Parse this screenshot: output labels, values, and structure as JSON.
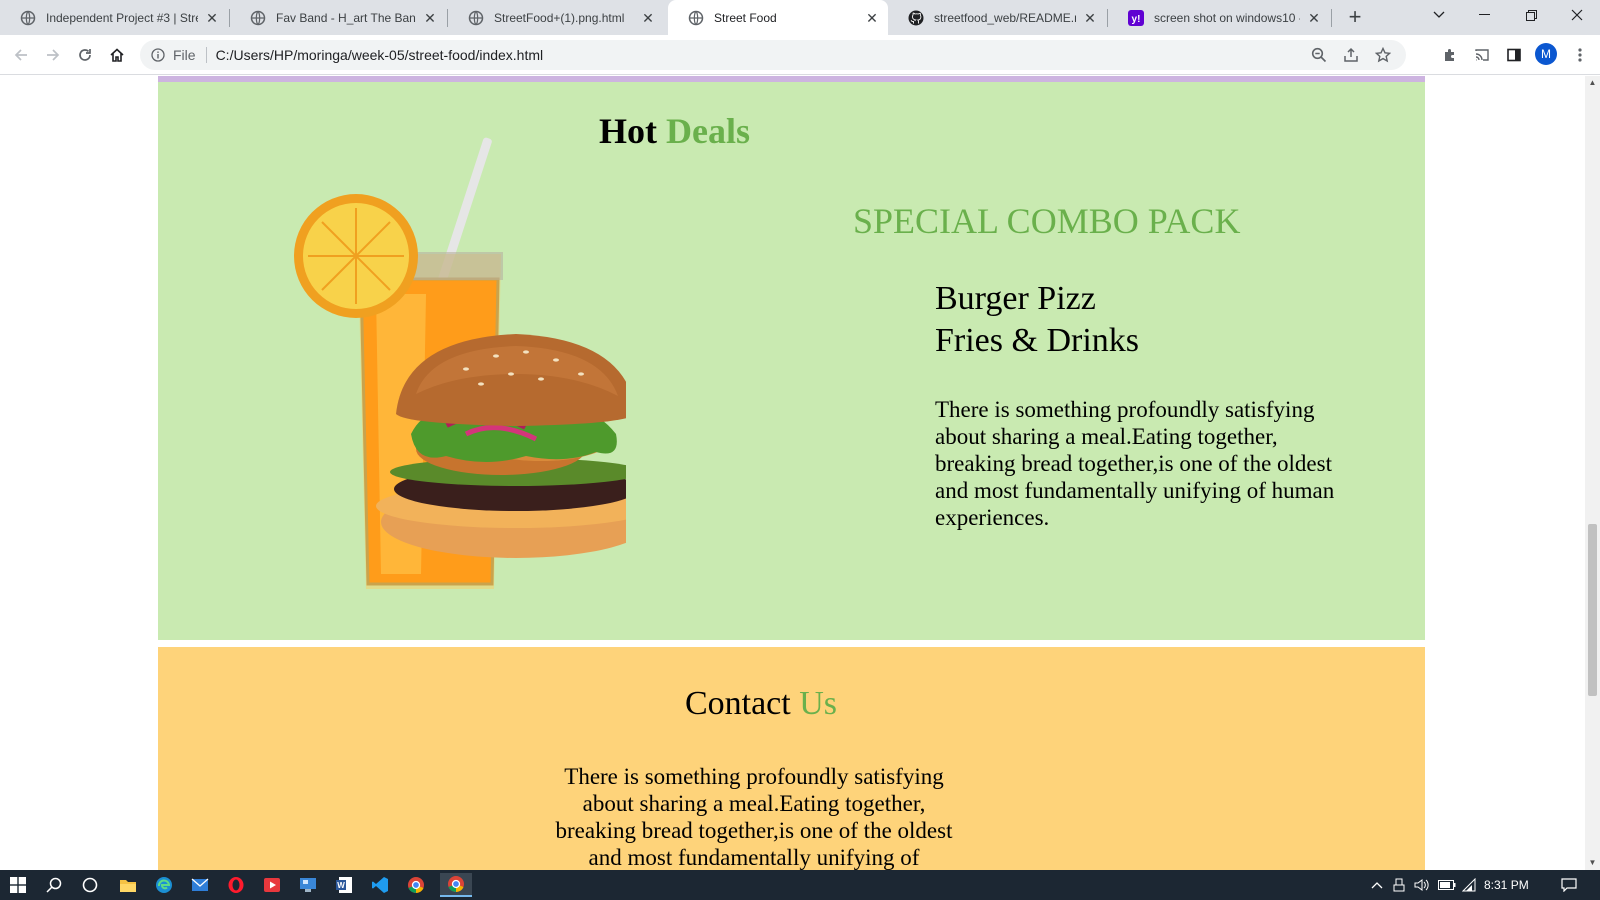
{
  "browser": {
    "tabs": [
      {
        "title": "Independent Project #3 | Stre",
        "active": false,
        "favicon": "globe-icon"
      },
      {
        "title": "Fav Band - H_art The Band",
        "active": false,
        "favicon": "globe-icon"
      },
      {
        "title": "StreetFood+(1).png.html",
        "active": false,
        "favicon": "globe-icon"
      },
      {
        "title": "Street Food",
        "active": true,
        "favicon": "globe-icon"
      },
      {
        "title": "streetfood_web/README.md",
        "active": false,
        "favicon": "github-icon"
      },
      {
        "title": "screen shot on windows10 - Y",
        "active": false,
        "favicon": "yahoo-icon"
      }
    ],
    "new_tab_label": "+",
    "omnibox": {
      "scheme_label": "File",
      "url": "C:/Users/HP/moringa/week-05/street-food/index.html"
    },
    "profile_initial": "M"
  },
  "page": {
    "hot_deals": {
      "heading_first": "Hot",
      "heading_accent": "Deals",
      "combo_title": "SPECIAL COMBO PACK",
      "combo_line1": "Burger Pizz",
      "combo_line2": "Fries & Drinks",
      "description": "There is something profoundly satisfying about sharing a meal.Eating together, breaking bread together,is one of the oldest and most fundamentally unifying of human experiences."
    },
    "contact": {
      "heading_first": "Contact",
      "heading_accent": "Us",
      "description": "There is something profoundly satisfying about sharing a meal.Eating together, breaking bread together,is one of the oldest and most fundamentally unifying of"
    }
  },
  "taskbar": {
    "clock": "8:31 PM"
  },
  "colors": {
    "accent_green": "#6ab04c",
    "hot_deals_bg": "#c9eab1",
    "contact_bg": "#fed37a",
    "top_strip": "#cdb4e0"
  }
}
